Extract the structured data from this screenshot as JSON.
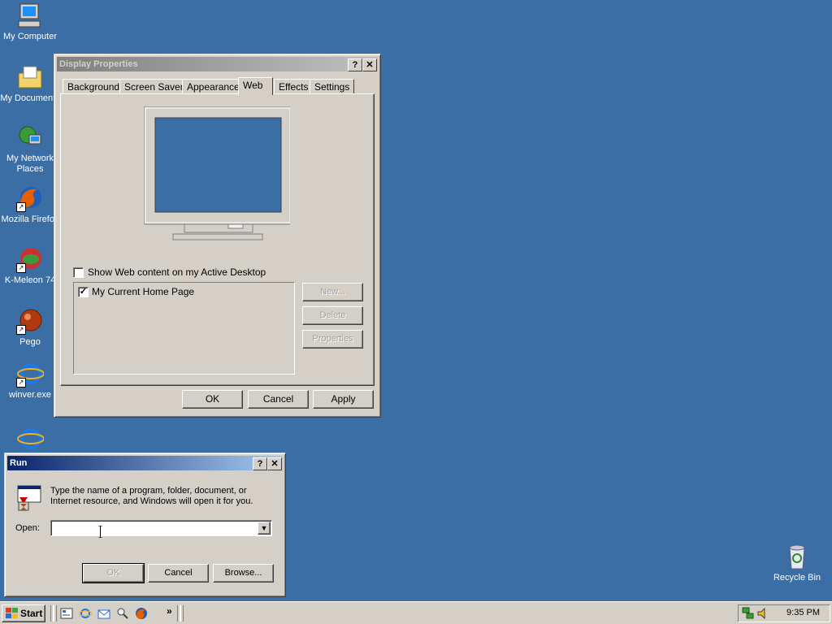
{
  "desktop": {
    "icons": [
      {
        "label": "My Computer"
      },
      {
        "label": "My Documents"
      },
      {
        "label": "My Network Places"
      },
      {
        "label": "Mozilla Firefox"
      },
      {
        "label": "K-Meleon 74"
      },
      {
        "label": "Pego"
      },
      {
        "label": "winver.exe"
      },
      {
        "label": ""
      },
      {
        "label": "Recycle Bin"
      }
    ]
  },
  "display_properties": {
    "title": "Display Properties",
    "help_glyph": "?",
    "close_glyph": "✕",
    "tabs": [
      "Background",
      "Screen Saver",
      "Appearance",
      "Web",
      "Effects",
      "Settings"
    ],
    "selected_tab": "Web",
    "show_web_content_label": "Show Web content on my Active Desktop",
    "show_web_content_checked": false,
    "list_items": [
      {
        "label": "My Current Home Page",
        "checked": true
      }
    ],
    "side_buttons": {
      "new": "New...",
      "delete": "Delete",
      "properties": "Properties"
    },
    "buttons": {
      "ok": "OK",
      "cancel": "Cancel",
      "apply": "Apply"
    },
    "monitor_screen_color": "#3a6ea5"
  },
  "run_dialog": {
    "title": "Run",
    "help_glyph": "?",
    "close_glyph": "✕",
    "description": "Type the name of a program, folder, document, or Internet resource, and Windows will open it for you.",
    "open_label": "Open:",
    "open_value": "",
    "buttons": {
      "ok": "OK",
      "cancel": "Cancel",
      "browse": "Browse..."
    }
  },
  "taskbar": {
    "start_label": "Start",
    "chevron": "»",
    "clock": "9:35 PM",
    "quicklaunch": [
      "show-desktop-icon",
      "internet-explorer-icon",
      "outlook-express-icon",
      "search-icon",
      "firefox-icon"
    ]
  },
  "colors": {
    "desktop": "#3a6ea5",
    "face": "#d4d0c8",
    "active_title": "#0a246a"
  }
}
